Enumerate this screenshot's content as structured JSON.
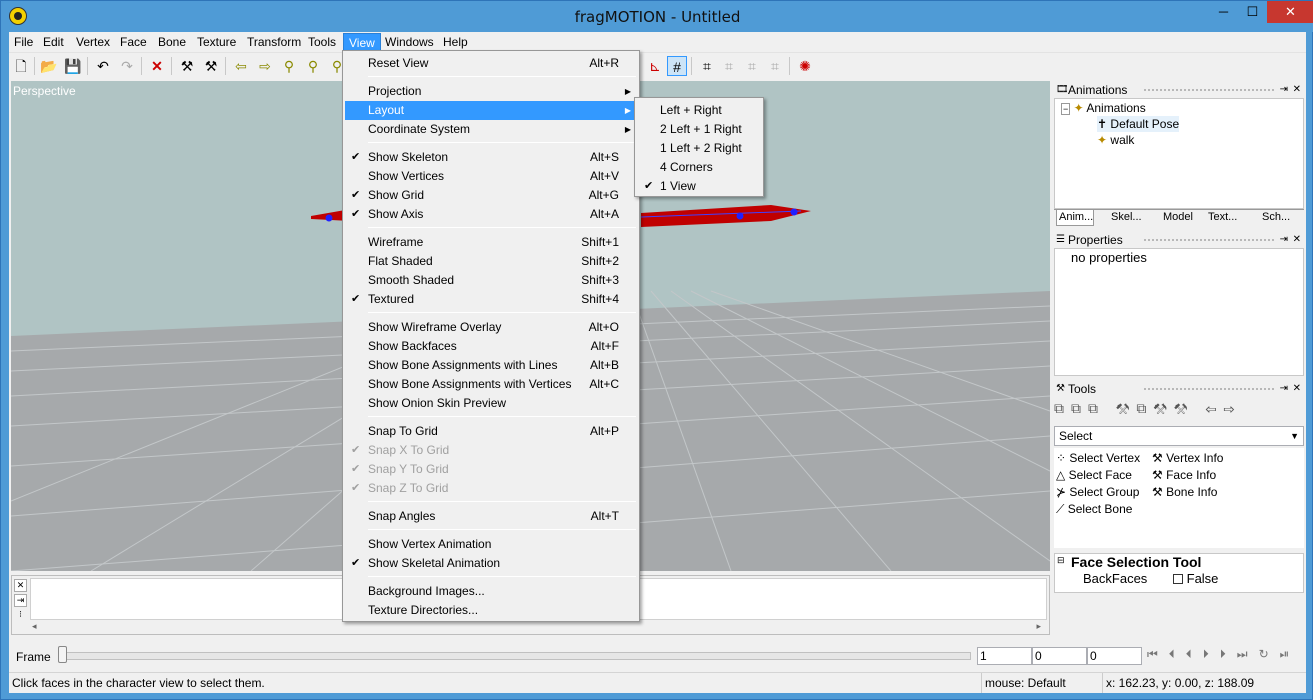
{
  "window": {
    "title": "fragMOTION - Untitled",
    "controls": {
      "minimize": "─",
      "maximize": "☐",
      "close": "✕"
    }
  },
  "menubar": [
    "File",
    "Edit",
    "Vertex",
    "Face",
    "Bone",
    "Texture",
    "Transform",
    "Tools",
    "View",
    "Windows",
    "Help"
  ],
  "menubar_active": "View",
  "viewport": {
    "label": "Perspective",
    "background": "#b0c4c4",
    "floor": "#a6a9ab"
  },
  "view_menu": {
    "items": [
      {
        "label": "Reset View",
        "shortcut": "Alt+R",
        "checked": false,
        "disabled": false,
        "submenu": false
      },
      {
        "label": "Projection",
        "shortcut": "",
        "checked": false,
        "disabled": false,
        "submenu": true
      },
      {
        "label": "Layout",
        "shortcut": "",
        "checked": false,
        "disabled": false,
        "submenu": true,
        "highlighted": true
      },
      {
        "label": "Coordinate System",
        "shortcut": "",
        "checked": false,
        "disabled": false,
        "submenu": true
      },
      {
        "label": "Show Skeleton",
        "shortcut": "Alt+S",
        "checked": true,
        "disabled": false
      },
      {
        "label": "Show Vertices",
        "shortcut": "Alt+V",
        "checked": false,
        "disabled": false
      },
      {
        "label": "Show Grid",
        "shortcut": "Alt+G",
        "checked": true,
        "disabled": false
      },
      {
        "label": "Show Axis",
        "shortcut": "Alt+A",
        "checked": true,
        "disabled": false
      },
      {
        "label": "Wireframe",
        "shortcut": "Shift+1",
        "checked": false,
        "disabled": false
      },
      {
        "label": "Flat Shaded",
        "shortcut": "Shift+2",
        "checked": false,
        "disabled": false
      },
      {
        "label": "Smooth Shaded",
        "shortcut": "Shift+3",
        "checked": false,
        "disabled": false
      },
      {
        "label": "Textured",
        "shortcut": "Shift+4",
        "checked": true,
        "disabled": false
      },
      {
        "label": "Show Wireframe Overlay",
        "shortcut": "Alt+O",
        "checked": false,
        "disabled": false
      },
      {
        "label": "Show Backfaces",
        "shortcut": "Alt+F",
        "checked": false,
        "disabled": false
      },
      {
        "label": "Show Bone Assignments with Lines",
        "shortcut": "Alt+B",
        "checked": false,
        "disabled": false
      },
      {
        "label": "Show Bone Assignments with Vertices",
        "shortcut": "Alt+C",
        "checked": false,
        "disabled": false
      },
      {
        "label": "Show Onion Skin Preview",
        "shortcut": "",
        "checked": false,
        "disabled": false
      },
      {
        "label": "Snap To Grid",
        "shortcut": "Alt+P",
        "checked": false,
        "disabled": false
      },
      {
        "label": "Snap X To Grid",
        "shortcut": "",
        "checked": true,
        "disabled": true
      },
      {
        "label": "Snap Y To Grid",
        "shortcut": "",
        "checked": true,
        "disabled": true
      },
      {
        "label": "Snap Z To Grid",
        "shortcut": "",
        "checked": true,
        "disabled": true
      },
      {
        "label": "Snap Angles",
        "shortcut": "Alt+T",
        "checked": false,
        "disabled": false
      },
      {
        "label": "Show Vertex Animation",
        "shortcut": "",
        "checked": false,
        "disabled": false
      },
      {
        "label": "Show Skeletal Animation",
        "shortcut": "",
        "checked": true,
        "disabled": false
      },
      {
        "label": "Background Images...",
        "shortcut": "",
        "checked": false,
        "disabled": false
      },
      {
        "label": "Texture Directories...",
        "shortcut": "",
        "checked": false,
        "disabled": false
      }
    ]
  },
  "layout_submenu": [
    {
      "label": "Left + Right",
      "checked": false
    },
    {
      "label": "2 Left + 1 Right",
      "checked": false
    },
    {
      "label": "1 Left + 2 Right",
      "checked": false
    },
    {
      "label": "4 Corners",
      "checked": false
    },
    {
      "label": "1 View",
      "checked": true
    }
  ],
  "animations_panel": {
    "title": "Animations",
    "tree": {
      "root": "Animations",
      "children": [
        "Default Pose",
        "walk"
      ]
    },
    "tabs": [
      "Anim...",
      "Skel...",
      "Model",
      "Text...",
      "Sch..."
    ]
  },
  "properties_panel": {
    "title": "Properties",
    "content": "no properties"
  },
  "tools_panel": {
    "title": "Tools",
    "select_value": "Select",
    "tools": [
      "Select Vertex",
      "Vertex Info",
      "Select Face",
      "Face Info",
      "Select Group",
      "Bone Info",
      "Select Bone"
    ]
  },
  "face_selection_tool": {
    "title": "Face Selection Tool",
    "rows": [
      {
        "name": "BackFaces",
        "value": "False"
      }
    ]
  },
  "frame_bar": {
    "label": "Frame",
    "fields": [
      "1",
      "0",
      "0"
    ]
  },
  "status": {
    "message": "Click faces in the character view to select them.",
    "mouse": "mouse: Default",
    "coords": "x: 162.23, y: 0.00, z: 188.09"
  }
}
